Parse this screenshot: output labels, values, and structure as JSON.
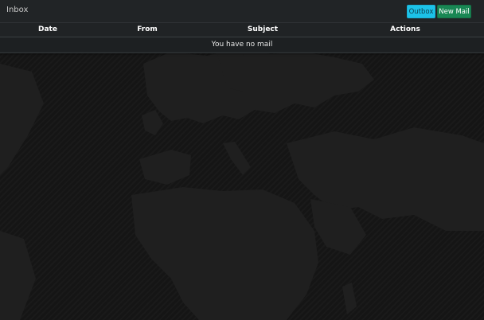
{
  "inbox": {
    "title": "Inbox",
    "buttons": {
      "outbox": "Outbox",
      "new_mail": "New Mail"
    },
    "columns": [
      "Date",
      "From",
      "Subject",
      "Actions"
    ],
    "empty_message": "You have no mail"
  },
  "colors": {
    "outbox_button": "#1cc2e8",
    "new_mail_button": "#198754",
    "panel_background": "#202325",
    "page_background": "#151515"
  }
}
